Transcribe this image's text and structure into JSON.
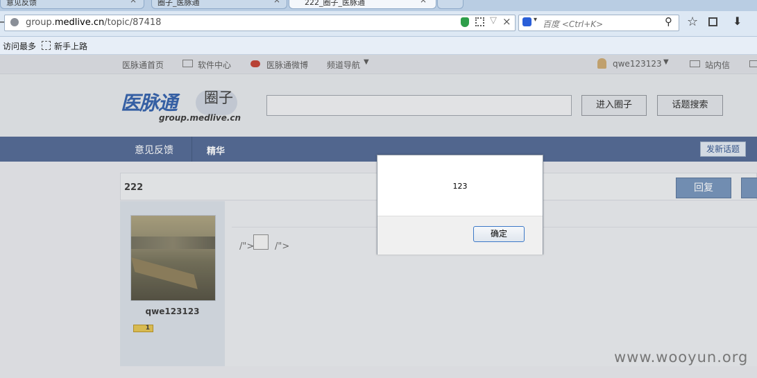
{
  "browser": {
    "tabs": [
      {
        "label": "意见反馈"
      },
      {
        "label": "圈子_医脉通"
      },
      {
        "label": "222_圈子_医脉通"
      }
    ],
    "url_prefix": "group.",
    "url_domain": "medlive.cn",
    "url_path": "/topic/87418",
    "search_placeholder": "百度 <Ctrl+K>",
    "bookmarks": [
      "访问最多",
      "新手上路"
    ]
  },
  "site": {
    "topnav": {
      "home": "医脉通首页",
      "software": "软件中心",
      "weibo": "医脉通微博",
      "channel": "频道导航",
      "username": "qwe123123",
      "messages": "站内信"
    },
    "logo_text": "医脉通",
    "logo_circle": "圈子",
    "logo_domain": "group.medlive.cn",
    "enter_button": "进入圈子",
    "search_button": "话题搜索",
    "bluebar": {
      "feedback": "意见反馈",
      "essence": "精华",
      "new_topic": "发新话题"
    },
    "topic": {
      "title": "222",
      "reply_button": "回复",
      "author": "qwe123123",
      "level": "1",
      "content_left": "/\">",
      "content_right": "/\">"
    }
  },
  "dialog": {
    "message": "123",
    "ok_label": "确定"
  },
  "watermark": "www.wooyun.org"
}
